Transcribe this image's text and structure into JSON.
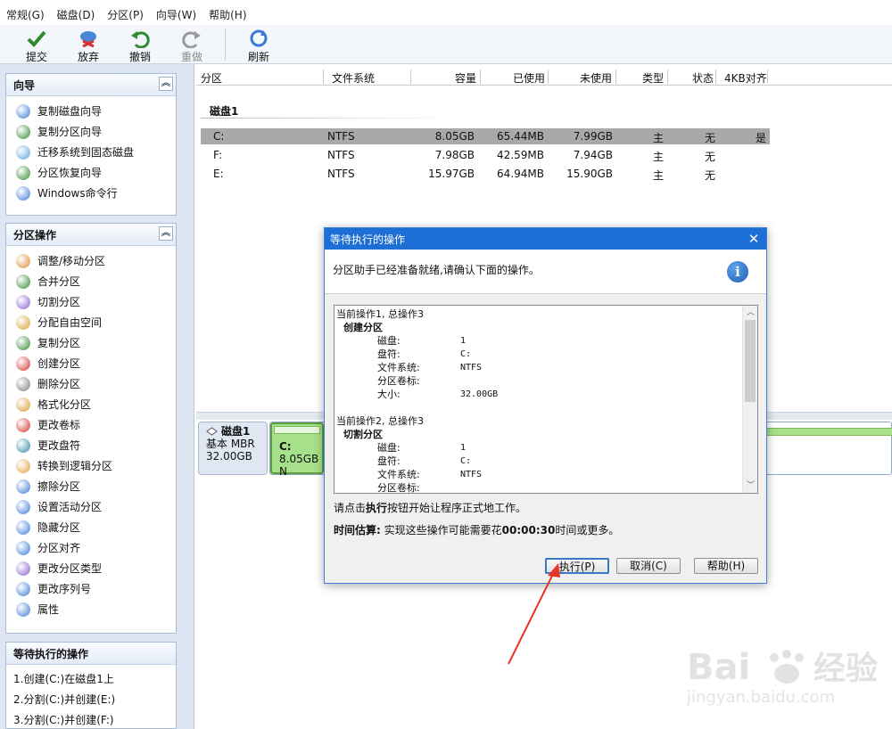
{
  "menu": [
    "常规(G)",
    "磁盘(D)",
    "分区(P)",
    "向导(W)",
    "帮助(H)"
  ],
  "toolbar": {
    "submit": "提交",
    "discard": "放弃",
    "undo": "撤销",
    "redo": "重做",
    "refresh": "刷新"
  },
  "wizard_panel": {
    "title": "向导",
    "items": [
      "复制磁盘向导",
      "复制分区向导",
      "迁移系统到固态磁盘",
      "分区恢复向导",
      "Windows命令行"
    ]
  },
  "ops_panel": {
    "title": "分区操作",
    "items": [
      "调整/移动分区",
      "合并分区",
      "切割分区",
      "分配自由空间",
      "复制分区",
      "创建分区",
      "删除分区",
      "格式化分区",
      "更改卷标",
      "更改盘符",
      "转换到逻辑分区",
      "擦除分区",
      "设置活动分区",
      "隐藏分区",
      "分区对齐",
      "更改分区类型",
      "更改序列号",
      "属性"
    ]
  },
  "pending_panel": {
    "title": "等待执行的操作",
    "items": [
      "1.创建(C:)在磁盘1上",
      "2.分割(C:)并创建(E:)",
      "3.分割(C:)并创建(F:)"
    ]
  },
  "table": {
    "headers": [
      "分区",
      "文件系统",
      "容量",
      "已使用",
      "未使用",
      "类型",
      "状态",
      "4KB对齐"
    ],
    "disk_label": "磁盘1",
    "rows": [
      [
        "C:",
        "NTFS",
        "8.05GB",
        "65.44MB",
        "7.99GB",
        "主",
        "无",
        "是"
      ],
      [
        "F:",
        "NTFS",
        "7.98GB",
        "42.59MB",
        "7.94GB",
        "主",
        "无",
        ""
      ],
      [
        "E:",
        "NTFS",
        "15.97GB",
        "64.94MB",
        "15.90GB",
        "主",
        "无",
        ""
      ]
    ]
  },
  "diskmap": {
    "name": "磁盘1",
    "type": "基本 MBR",
    "size": "32.00GB",
    "part_letter": "C:",
    "part_info": "8.05GB N"
  },
  "dialog": {
    "title": "等待执行的操作",
    "close": "✕",
    "header_text": "分区助手已经准备就绪,请确认下面的操作。",
    "info_icon": "i",
    "log": [
      {
        "type": "op",
        "text": "当前操作1, 总操作3"
      },
      {
        "type": "name",
        "text": "创建分区"
      },
      {
        "type": "kv",
        "k": "磁盘:",
        "v": "1"
      },
      {
        "type": "kv",
        "k": "盘符:",
        "v": "C:"
      },
      {
        "type": "kv",
        "k": "文件系统:",
        "v": "NTFS"
      },
      {
        "type": "kv",
        "k": "分区卷标:",
        "v": ""
      },
      {
        "type": "kv",
        "k": "大小:",
        "v": "32.00GB"
      },
      {
        "type": "blank",
        "text": ""
      },
      {
        "type": "op",
        "text": "当前操作2, 总操作3"
      },
      {
        "type": "name",
        "text": "切割分区"
      },
      {
        "type": "kv",
        "k": "磁盘:",
        "v": "1"
      },
      {
        "type": "kv",
        "k": "盘符:",
        "v": "C:"
      },
      {
        "type": "kv",
        "k": "文件系统:",
        "v": "NTFS"
      },
      {
        "type": "kv",
        "k": "分区卷标:",
        "v": ""
      }
    ],
    "hint_pre": "请点击",
    "hint_bold": "执行",
    "hint_post": "按钮开始让程序正式地工作。",
    "est_label": "时间估算:",
    "est_pre": " 实现这些操作可能需要花",
    "est_time": "00:00:30",
    "est_post": "时间或更多。",
    "buttons": {
      "execute": "执行(P)",
      "cancel": "取消(C)",
      "help": "帮助(H)"
    }
  },
  "watermark": {
    "text": "Bai经验",
    "sub": "jingyan.baidu.com"
  },
  "colors": {
    "accent": "#1d6fd5",
    "partition_green": "#a6e08a",
    "arrow": "#e8342b"
  }
}
